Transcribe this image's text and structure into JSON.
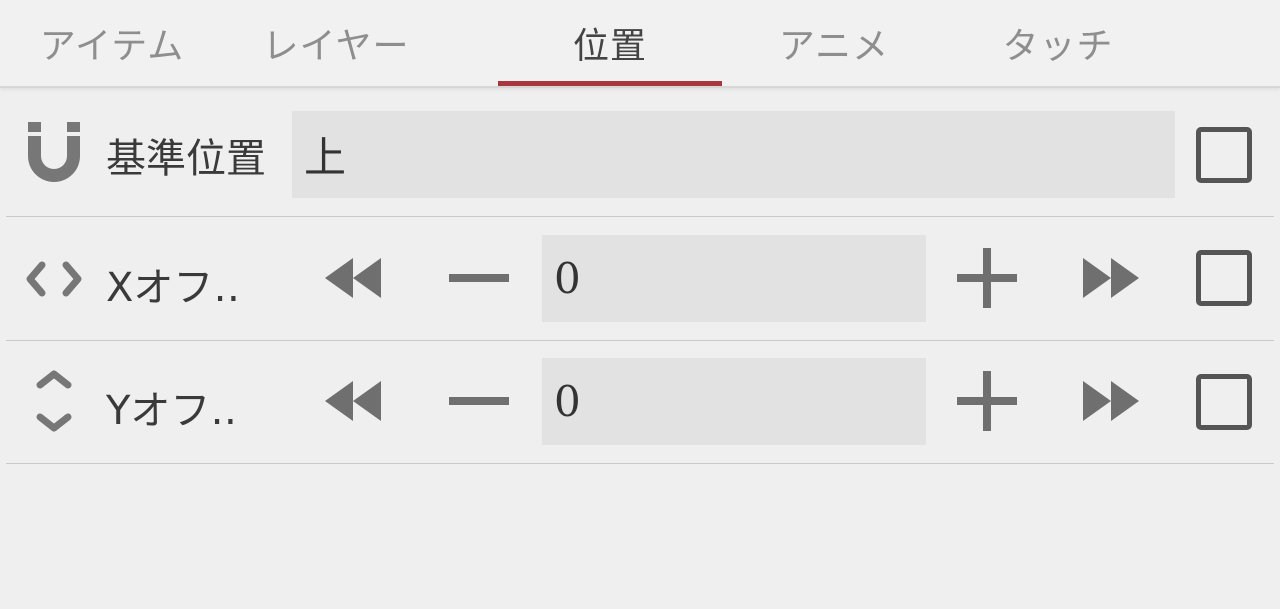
{
  "tabs": [
    {
      "label": "アイテム"
    },
    {
      "label": "レイヤー"
    },
    {
      "label": "位置",
      "active": true
    },
    {
      "label": "アニメ"
    },
    {
      "label": "タッチ"
    }
  ],
  "accent_color": "#a8353f",
  "rows": {
    "base": {
      "icon": "magnet-icon",
      "label": "基準位置",
      "value": "上",
      "checked": false
    },
    "xoffset": {
      "icon": "horizontal-arrows-icon",
      "label": "Xオフ‥",
      "value": "0",
      "checked": false
    },
    "yoffset": {
      "icon": "vertical-arrows-icon",
      "label": "Yオフ‥",
      "value": "0",
      "checked": false
    }
  }
}
